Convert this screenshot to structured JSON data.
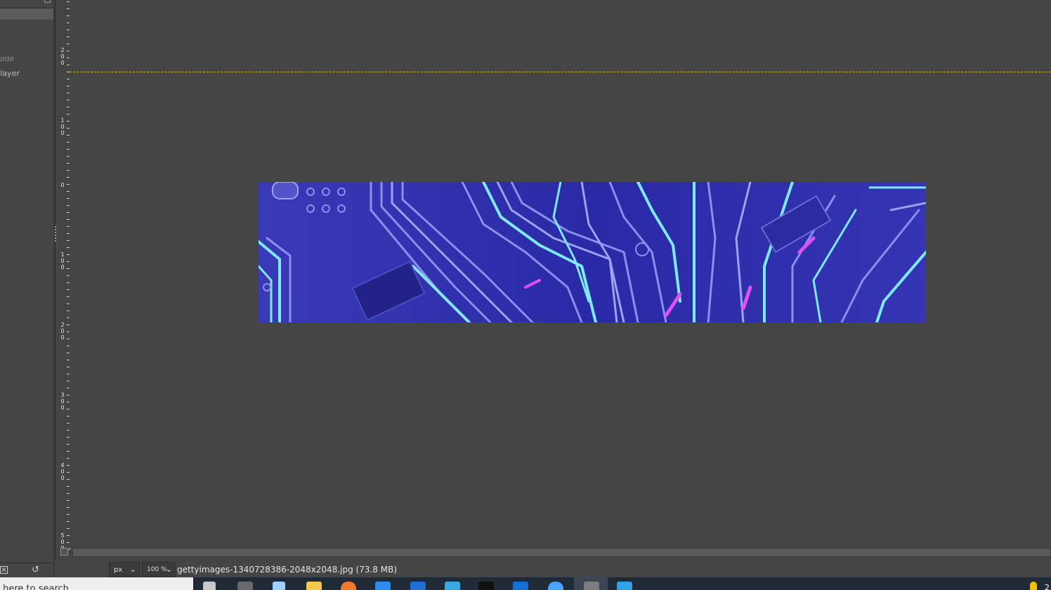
{
  "left_dock": {
    "line1": "Guide",
    "line2": "e layer",
    "footer_icons": [
      "delete-icon",
      "reset-icon"
    ]
  },
  "ruler": {
    "labels": [
      "2\n0\n0",
      "1\n0\n0",
      "0",
      "1\n0\n0",
      "2\n0\n0",
      "3\n0\n0",
      "4\n0\n0",
      "5\n0\n0"
    ]
  },
  "canvas": {
    "image_description": "circuit board",
    "guide_color": "#d8c21a"
  },
  "statusbar": {
    "unit": "px",
    "zoom": "100 %",
    "file_info": "gettyimages-1340728386-2048x2048.jpg (73.8 MB)"
  },
  "taskbar": {
    "search_placeholder": "e here to search",
    "tray_text": "2"
  },
  "colors": {
    "background": "#454545",
    "image_deep_blue": "#2a2aa6",
    "trace_cyan": "#7fe9ff",
    "trace_lavender": "#8e8ef0",
    "trace_magenta": "#e050f0"
  }
}
